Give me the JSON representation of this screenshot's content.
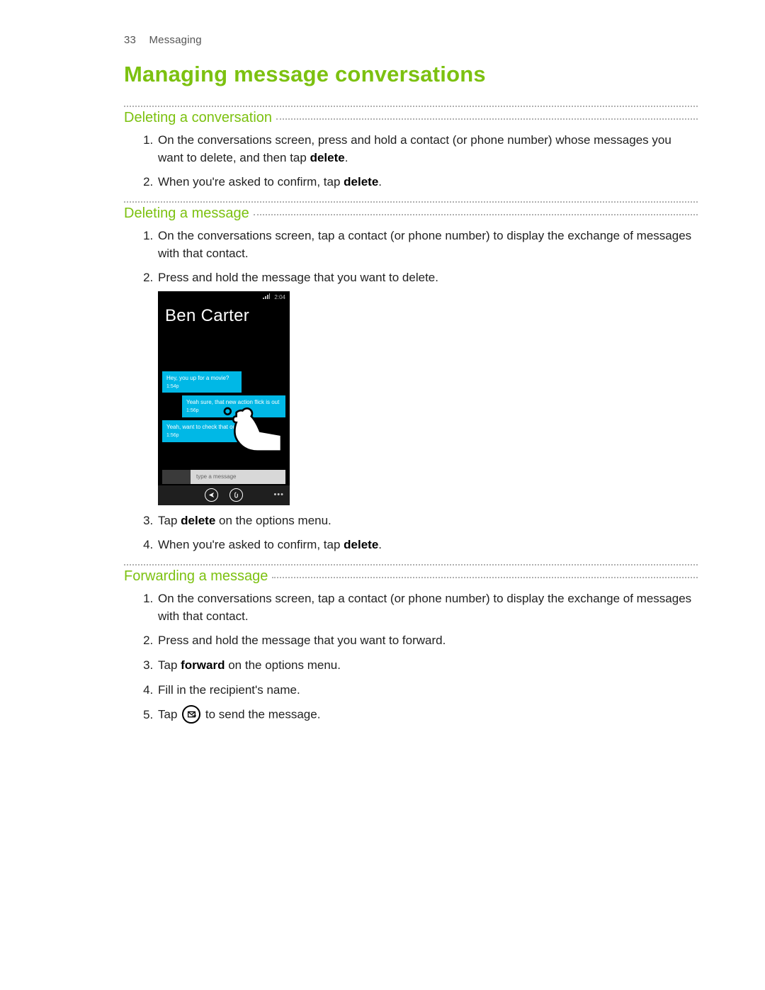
{
  "header": {
    "page_number": "33",
    "section": "Messaging"
  },
  "title": "Managing message conversations",
  "sections": {
    "del_conv": {
      "heading": "Deleting a conversation",
      "steps": {
        "s1_a": "On the conversations screen, press and hold a contact (or phone number) whose messages you want to delete, and then tap ",
        "s1_b": "delete",
        "s1_c": ".",
        "s2_a": "When you're asked to confirm, tap ",
        "s2_b": "delete",
        "s2_c": "."
      }
    },
    "del_msg": {
      "heading": "Deleting a message",
      "steps": {
        "s1": "On the conversations screen, tap a contact (or phone number) to display the exchange of messages with that contact.",
        "s2": "Press and hold the message that you want to delete.",
        "s3_a": "Tap ",
        "s3_b": "delete",
        "s3_c": " on the options menu.",
        "s4_a": "When you're asked to confirm, tap ",
        "s4_b": "delete",
        "s4_c": "."
      }
    },
    "fwd_msg": {
      "heading": "Forwarding a message",
      "steps": {
        "s1": "On the conversations screen, tap a contact (or phone number) to display the exchange of messages with that contact.",
        "s2": "Press and hold the message that you want to forward.",
        "s3_a": "Tap ",
        "s3_b": "forward",
        "s3_c": " on the options menu.",
        "s4": "Fill in the recipient's name.",
        "s5_a": "Tap ",
        "s5_b": " to send the message."
      }
    }
  },
  "phone": {
    "time": "2:04",
    "contact_name": "Ben Carter",
    "bubbles": {
      "b1_text": "Hey, you up for a movie?",
      "b1_time": "1:54p",
      "b2_text": "Yeah sure, that new action flick is out",
      "b2_time": "1:56p",
      "b3_text": "Yeah, want to check that ou",
      "b3_time": "1:56p"
    },
    "input_placeholder": "type a message"
  }
}
